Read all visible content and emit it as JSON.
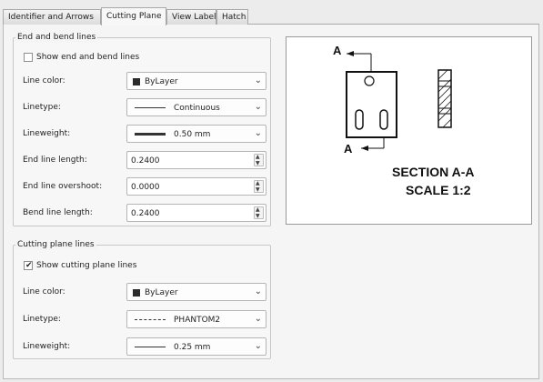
{
  "tabs": [
    {
      "label": "Identifier and Arrows"
    },
    {
      "label": "Cutting Plane"
    },
    {
      "label": "View Label"
    },
    {
      "label": "Hatch"
    }
  ],
  "active_tab": "Cutting Plane",
  "end_bend": {
    "title": "End and bend lines",
    "show_label": "Show end and bend lines",
    "show_checked": false,
    "line_color_label": "Line color:",
    "line_color_value": "ByLayer",
    "linetype_label": "Linetype:",
    "linetype_value": "Continuous",
    "lineweight_label": "Lineweight:",
    "lineweight_value": "0.50 mm",
    "end_length_label": "End line length:",
    "end_length_value": "0.2400",
    "end_overshoot_label": "End line overshoot:",
    "end_overshoot_value": "0.0000",
    "bend_length_label": "Bend line length:",
    "bend_length_value": "0.2400"
  },
  "cutting_plane": {
    "title": "Cutting plane lines",
    "show_label": "Show cutting plane lines",
    "show_checked": true,
    "line_color_label": "Line color:",
    "line_color_value": "ByLayer",
    "linetype_label": "Linetype:",
    "linetype_value": "PHANTOM2",
    "lineweight_label": "Lineweight:",
    "lineweight_value": "0.25 mm"
  },
  "preview": {
    "label_top": "A",
    "label_bottom": "A",
    "section_title": "SECTION A-A",
    "scale": "SCALE 1:2"
  },
  "icons": {
    "dropdown": "chevron-down-icon",
    "spin_up": "up-arrow-icon",
    "spin_down": "down-arrow-icon",
    "check": "checkmark-icon"
  },
  "colors": {
    "color_swatch": "#2a2a2a",
    "panel_bg": "#f5f5f5"
  }
}
